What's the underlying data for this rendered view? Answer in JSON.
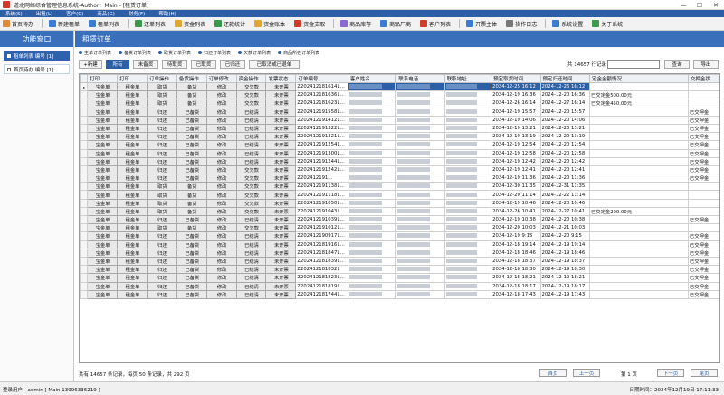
{
  "window": {
    "title": "道北网络综合管理信息系统-Author：Main - [租赁订单]",
    "controls": [
      "—",
      "☐",
      "✕"
    ]
  },
  "menubar": [
    "系统(S)",
    "出租(L)",
    "客户(C)",
    "商品(G)",
    "财务(F)",
    "帮助(H)"
  ],
  "toolbar": [
    {
      "label": "首页待办",
      "icon": "home-icon",
      "color": "#e0893a"
    },
    {
      "label": "新建租单",
      "icon": "new-order-icon",
      "color": "#3a7bd5"
    },
    {
      "label": "租单列表",
      "icon": "order-list-icon",
      "color": "#3a7bd5"
    },
    {
      "label": "还单列表",
      "icon": "return-list-icon",
      "color": "#3a9a4a"
    },
    {
      "label": "资金列表",
      "icon": "funds-list-icon",
      "color": "#e0a830"
    },
    {
      "label": "还款统计",
      "icon": "repayment-stats-icon",
      "color": "#3a9a4a"
    },
    {
      "label": "资金账本",
      "icon": "ledger-icon",
      "color": "#e0a830"
    },
    {
      "label": "资金支取",
      "icon": "withdraw-icon",
      "color": "#d23b2a"
    },
    {
      "label": "商品库存",
      "icon": "stock-icon",
      "color": "#8a6ad0"
    },
    {
      "label": "商品厂商",
      "icon": "vendor-icon",
      "color": "#3a7bd5"
    },
    {
      "label": "客户列表",
      "icon": "customer-list-icon",
      "color": "#d23b2a"
    },
    {
      "label": "开票主体",
      "icon": "invoice-icon",
      "color": "#3a7bd5"
    },
    {
      "label": "操作日志",
      "icon": "log-icon",
      "color": "#777777"
    },
    {
      "label": "系统设置",
      "icon": "settings-icon",
      "color": "#3a7bd5"
    },
    {
      "label": "关于系统",
      "icon": "about-icon",
      "color": "#3a9a4a"
    }
  ],
  "left_panel": {
    "title": "功能窗口",
    "items": [
      {
        "label": "租单列表 编号 [1]",
        "active": true
      },
      {
        "label": "首页待办 编号 [1]",
        "active": false
      }
    ]
  },
  "main": {
    "title": "租赁订单",
    "tabs": [
      "主单订单列表",
      "备货订单列表",
      "取货订单列表",
      "归还订单列表",
      "欠款订单列表",
      "商品所在订单列表"
    ],
    "filters": [
      {
        "label": "+新建",
        "active": false
      },
      {
        "label": "所有",
        "active": true
      },
      {
        "label": "未备货",
        "active": false
      },
      {
        "label": "待取货",
        "active": false
      },
      {
        "label": "已取货",
        "active": false
      },
      {
        "label": "已归还",
        "active": false
      },
      {
        "label": "已取消或已退单",
        "active": false
      }
    ],
    "record_count_label": "共 14657 行记录：",
    "search_placeholder": "",
    "search_button": "查询",
    "export_button": "导出"
  },
  "table": {
    "columns": [
      "",
      "打印",
      "打印",
      "订单操作",
      "备货操作",
      "订单修改",
      "资金操作",
      "发票状态",
      "订单编号",
      "客户姓名",
      "联系电话",
      "联系地址",
      "预定取货时间",
      "预定归还时间",
      "定金金额情况",
      "交押金状"
    ],
    "rows": [
      {
        "ind": "▸",
        "op": "取货",
        "stock": "备货",
        "money": "交欠款",
        "inv": "未开票",
        "id": "Z2024121816141...",
        "pick": "2024-12-25 16:12",
        "ret": "2024-12-26 16:12",
        "deposit_note": "",
        "pay": ""
      },
      {
        "ind": "",
        "op": "取货",
        "stock": "备货",
        "money": "交欠款",
        "inv": "未开票",
        "id": "Z2024121816361...",
        "pick": "2024-12-19 16:36",
        "ret": "2024-12-20 16:36",
        "deposit_note": "已交定金500.00元",
        "pay": ""
      },
      {
        "ind": "",
        "op": "取货",
        "stock": "备货",
        "money": "交欠款",
        "inv": "未开票",
        "id": "Z2024121816231...",
        "pick": "2024-12-26 16:14",
        "ret": "2024-12-27 16:14",
        "deposit_note": "已交定金450.00元",
        "pay": ""
      },
      {
        "ind": "",
        "op": "归还",
        "stock": "已备货",
        "money": "已结清",
        "inv": "未开票",
        "id": "Z2024121915581...",
        "pick": "2024-12-19 15:57",
        "ret": "2024-12-20 15:57",
        "deposit_note": "",
        "pay": "已交押金"
      },
      {
        "ind": "",
        "op": "归还",
        "stock": "已备货",
        "money": "已结清",
        "inv": "未开票",
        "id": "Z2024121914121...",
        "pick": "2024-12-19 14:06",
        "ret": "2024-12-20 14:06",
        "deposit_note": "",
        "pay": "已交押金"
      },
      {
        "ind": "",
        "op": "归还",
        "stock": "已备货",
        "money": "已结清",
        "inv": "未开票",
        "id": "Z2024121913221...",
        "pick": "2024-12-19 13:21",
        "ret": "2024-12-20 13:21",
        "deposit_note": "",
        "pay": "已交押金"
      },
      {
        "ind": "",
        "op": "归还",
        "stock": "已备货",
        "money": "已结清",
        "inv": "未开票",
        "id": "Z2024121913211...",
        "pick": "2024-12-19 13:19",
        "ret": "2024-12-20 13:19",
        "deposit_note": "",
        "pay": "已交押金"
      },
      {
        "ind": "",
        "op": "归还",
        "stock": "已备货",
        "money": "已结清",
        "inv": "未开票",
        "id": "Z2024121912541...",
        "pick": "2024-12-19 12:54",
        "ret": "2024-12-20 12:54",
        "deposit_note": "",
        "pay": "已交押金"
      },
      {
        "ind": "",
        "op": "归还",
        "stock": "已备货",
        "money": "已结清",
        "inv": "未开票",
        "id": "Z2024121913001...",
        "pick": "2024-12-19 12:58",
        "ret": "2024-12-20 12:58",
        "deposit_note": "",
        "pay": "已交押金"
      },
      {
        "ind": "",
        "op": "归还",
        "stock": "已备货",
        "money": "已结清",
        "inv": "未开票",
        "id": "Z2024121912441...",
        "pick": "2024-12-19 12:42",
        "ret": "2024-12-20 12:42",
        "deposit_note": "",
        "pay": "已交押金"
      },
      {
        "ind": "",
        "op": "归还",
        "stock": "已备货",
        "money": "交欠款",
        "inv": "未开票",
        "id": "Z2024121912421...",
        "pick": "2024-12-19 12:41",
        "ret": "2024-12-20 12:41",
        "deposit_note": "",
        "pay": "已交押金"
      },
      {
        "ind": "",
        "op": "归还",
        "stock": "已备货",
        "money": "交欠款",
        "inv": "未开票",
        "id": "Z202412191...",
        "pick": "2024-12-19 11:36",
        "ret": "2024-12-20 11:36",
        "deposit_note": "",
        "pay": "已交押金"
      },
      {
        "ind": "",
        "op": "取货",
        "stock": "备货",
        "money": "交欠款",
        "inv": "未开票",
        "id": "Z2024121911381...",
        "pick": "2024-12-30 11:35",
        "ret": "2024-12-31 11:35",
        "deposit_note": "",
        "pay": ""
      },
      {
        "ind": "",
        "op": "取货",
        "stock": "备货",
        "money": "交欠款",
        "inv": "未开票",
        "id": "Z2024121911181...",
        "pick": "2024-12-20 11:14",
        "ret": "2024-12-22 11:14",
        "deposit_note": "",
        "pay": ""
      },
      {
        "ind": "",
        "op": "取货",
        "stock": "备货",
        "money": "交欠款",
        "inv": "未开票",
        "id": "Z2024121910501...",
        "pick": "2024-12-19 10:46",
        "ret": "2024-12-20 10:46",
        "deposit_note": "",
        "pay": ""
      },
      {
        "ind": "",
        "op": "取货",
        "stock": "备货",
        "money": "交欠款",
        "inv": "未开票",
        "id": "Z2024121910431...",
        "pick": "2024-12-26 10:41",
        "ret": "2024-12-27 10:41",
        "deposit_note": "已交定金200.00元",
        "pay": ""
      },
      {
        "ind": "",
        "op": "归还",
        "stock": "已备货",
        "money": "已结清",
        "inv": "未开票",
        "id": "Z2024121910391...",
        "pick": "2024-12-19 10:38",
        "ret": "2024-12-20 10:38",
        "deposit_note": "",
        "pay": "已交押金"
      },
      {
        "ind": "",
        "op": "取货",
        "stock": "备货",
        "money": "交欠款",
        "inv": "未开票",
        "id": "Z2024121910121...",
        "pick": "2024-12-20 10:03",
        "ret": "2024-12-21 10:03",
        "deposit_note": "",
        "pay": ""
      },
      {
        "ind": "",
        "op": "归还",
        "stock": "已备货",
        "money": "已结清",
        "inv": "未开票",
        "id": "Z2024121909171...",
        "pick": "2024-12-19 9:15",
        "ret": "2024-12-20 9:15",
        "deposit_note": "",
        "pay": "已交押金"
      },
      {
        "ind": "",
        "op": "归还",
        "stock": "已备货",
        "money": "已结清",
        "inv": "未开票",
        "id": "Z2024121819161...",
        "pick": "2024-12-18 19:14",
        "ret": "2024-12-19 19:14",
        "deposit_note": "",
        "pay": "已交押金"
      },
      {
        "ind": "",
        "op": "归还",
        "stock": "已备货",
        "money": "已结清",
        "inv": "未开票",
        "id": "Z2024121818471...",
        "pick": "2024-12-18 18:46",
        "ret": "2024-12-19 18:46",
        "deposit_note": "",
        "pay": "已交押金"
      },
      {
        "ind": "",
        "op": "归还",
        "stock": "已备货",
        "money": "已结清",
        "inv": "未开票",
        "id": "Z2024121818391...",
        "pick": "2024-12-18 18:37",
        "ret": "2024-12-19 18:37",
        "deposit_note": "",
        "pay": "已交押金"
      },
      {
        "ind": "",
        "op": "归还",
        "stock": "已备货",
        "money": "已结清",
        "inv": "未开票",
        "id": "Z2024121818321",
        "pick": "2024-12-18 18:30",
        "ret": "2024-12-19 18:30",
        "deposit_note": "",
        "pay": "已交押金"
      },
      {
        "ind": "",
        "op": "归还",
        "stock": "已备货",
        "money": "已结清",
        "inv": "未开票",
        "id": "Z2024121818231...",
        "pick": "2024-12-18 18:21",
        "ret": "2024-12-19 18:21",
        "deposit_note": "",
        "pay": "已交押金"
      },
      {
        "ind": "",
        "op": "归还",
        "stock": "已备货",
        "money": "已结清",
        "inv": "未开票",
        "id": "Z2024121818191...",
        "pick": "2024-12-18 18:17",
        "ret": "2024-12-19 18:17",
        "deposit_note": "",
        "pay": "已交押金"
      },
      {
        "ind": "",
        "op": "归还",
        "stock": "已备货",
        "money": "已结清",
        "inv": "未开票",
        "id": "Z2024121817441...",
        "pick": "2024-12-18 17:43",
        "ret": "2024-12-19 17:43",
        "deposit_note": "",
        "pay": "已交押金"
      }
    ],
    "fixed_labels": {
      "print1": "宝金单",
      "print2": "租金单",
      "edit": "修改"
    }
  },
  "pager": {
    "info": "共有 14657 条记录，每页 50 条记录，共 292 页",
    "first": "首页",
    "prev": "上一页",
    "page": "第 1 页",
    "next": "下一页",
    "last": "尾页"
  },
  "statusbar": {
    "left": "登录用户：admin [ Main 13996336219 ]",
    "right": "日期时间：2024年12月19日 17:11:33"
  },
  "colors": {
    "accent": "#2d5fa6",
    "header": "#3a6fbb"
  }
}
